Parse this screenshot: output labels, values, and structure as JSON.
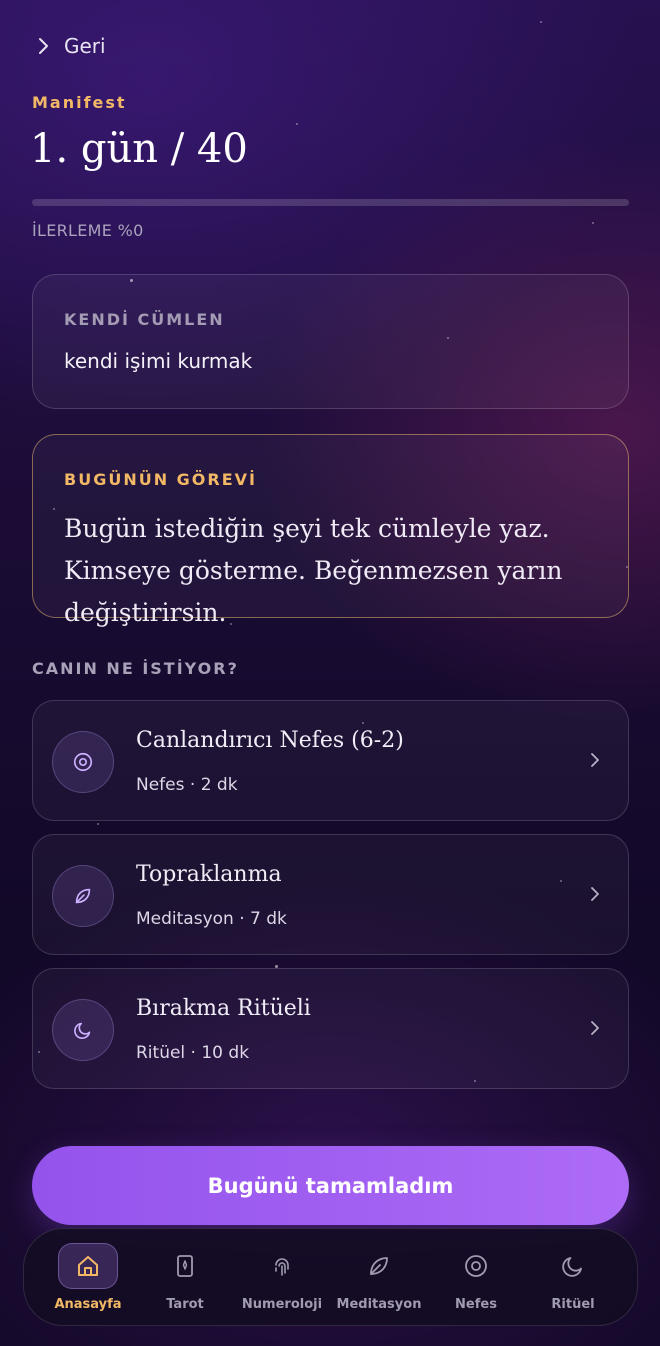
{
  "header": {
    "back_label": "Geri",
    "eyebrow": "Manifest",
    "title": "1. gün / 40"
  },
  "progress": {
    "value_percent": 0,
    "label": "İLERLEME %0"
  },
  "own_sentence": {
    "label": "KENDİ CÜMLEN",
    "value": "kendi işimi kurmak"
  },
  "today_task": {
    "label": "BUGÜNÜN GÖREVİ",
    "text": "Bugün istediğin şeyi tek cümleyle yaz. Kimseye gösterme. Beğenmezsen yarın değiştirirsin."
  },
  "suggestions": {
    "heading": "CANIN NE İSTİYOR?",
    "items": [
      {
        "name": "Canlandırıcı Nefes (6-2)",
        "meta": "Nefes · 2 dk",
        "icon": "target-icon"
      },
      {
        "name": "Topraklanma",
        "meta": "Meditasyon · 7 dk",
        "icon": "leaf-icon"
      },
      {
        "name": "Bırakma Ritüeli",
        "meta": "Ritüel · 10 dk",
        "icon": "moon-icon"
      }
    ]
  },
  "cta": {
    "label": "Bugünü tamamladım"
  },
  "bottom_nav": {
    "active": "Anasayfa",
    "items": [
      {
        "label": "Anasayfa",
        "icon": "home-icon"
      },
      {
        "label": "Tarot",
        "icon": "tarot-card-icon"
      },
      {
        "label": "Numeroloji",
        "icon": "fingerprint-icon"
      },
      {
        "label": "Meditasyon",
        "icon": "leaf-icon"
      },
      {
        "label": "Nefes",
        "icon": "target-icon"
      },
      {
        "label": "Ritüel",
        "icon": "moon-icon"
      }
    ]
  },
  "colors": {
    "accent_gold": "#f2b866",
    "accent_purple": "#a062f2",
    "background": "#1a0c34"
  }
}
